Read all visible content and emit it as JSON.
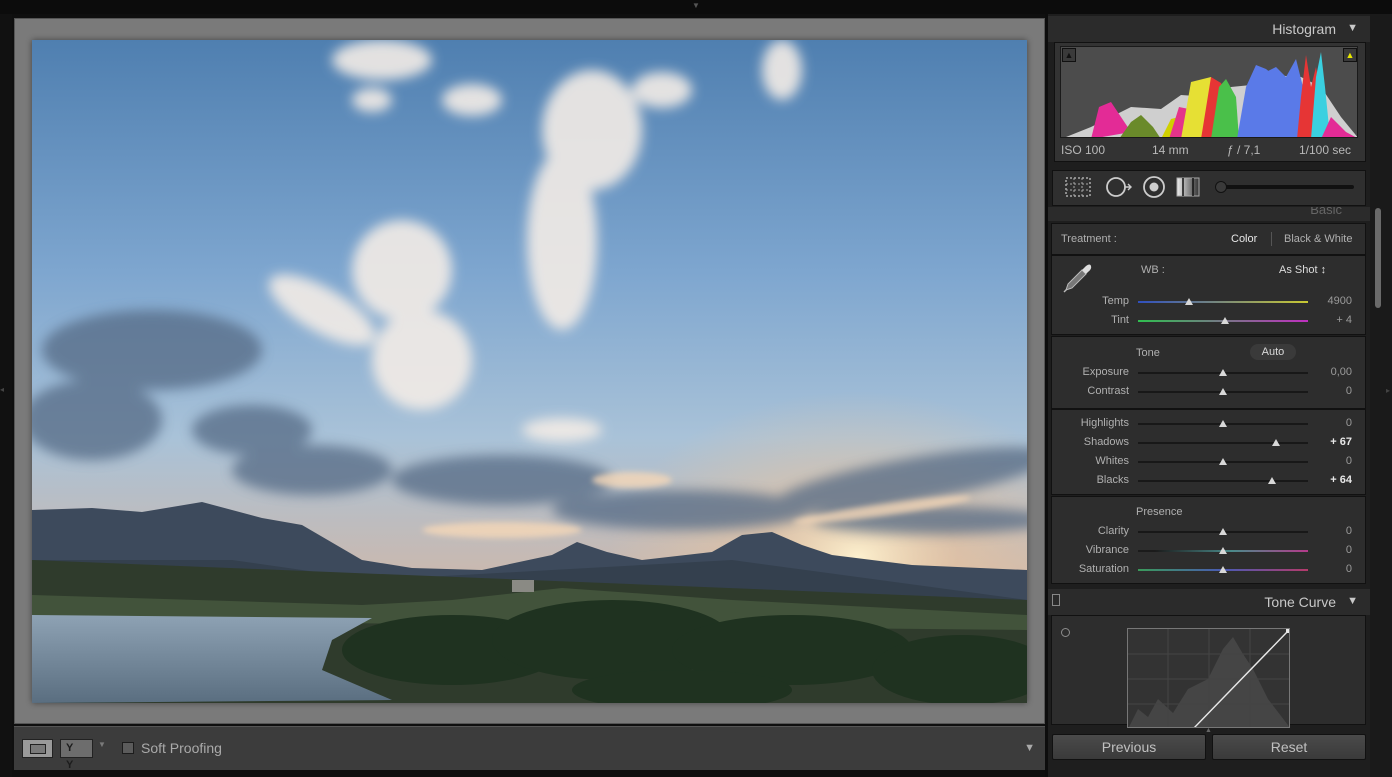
{
  "histogram": {
    "title": "Histogram",
    "exif": {
      "iso": "ISO 100",
      "focal": "14 mm",
      "aperture": "ƒ / 7,1",
      "shutter": "1/100 sec"
    }
  },
  "basic": {
    "title_cut": "Basic",
    "treatment_label": "Treatment :",
    "treatment_options": [
      "Color",
      "Black & White"
    ],
    "wb_label": "WB :",
    "wb_value": "As Shot ↕",
    "wb_sliders": [
      {
        "label": "Temp",
        "value": "4900",
        "fraction": 0.3,
        "bright": false
      },
      {
        "label": "Tint",
        "value": "+ 4",
        "fraction": 0.51,
        "bright": false
      }
    ],
    "tone_label": "Tone",
    "auto_label": "Auto",
    "tone_sliders_a": [
      {
        "label": "Exposure",
        "value": "0,00",
        "fraction": 0.5,
        "bright": false
      },
      {
        "label": "Contrast",
        "value": "0",
        "fraction": 0.5,
        "bright": false
      }
    ],
    "tone_sliders_b": [
      {
        "label": "Highlights",
        "value": "0",
        "fraction": 0.5,
        "bright": false
      },
      {
        "label": "Shadows",
        "value": "+ 67",
        "fraction": 0.81,
        "bright": true
      },
      {
        "label": "Whites",
        "value": "0",
        "fraction": 0.5,
        "bright": false
      },
      {
        "label": "Blacks",
        "value": "+ 64",
        "fraction": 0.79,
        "bright": true
      }
    ],
    "presence_label": "Presence",
    "presence_sliders": [
      {
        "label": "Clarity",
        "value": "0",
        "fraction": 0.5,
        "bright": false
      },
      {
        "label": "Vibrance",
        "value": "0",
        "fraction": 0.5,
        "bright": false
      },
      {
        "label": "Saturation",
        "value": "0",
        "fraction": 0.5,
        "bright": false
      }
    ]
  },
  "tone_curve": {
    "title": "Tone Curve"
  },
  "buttons": {
    "previous": "Previous",
    "reset": "Reset"
  },
  "toolbar": {
    "soft_proofing": "Soft Proofing",
    "compare_label": "Y Y"
  },
  "icons": {
    "crop": "crop-overlay-icon",
    "spot": "spot-removal-icon",
    "redeye": "red-eye-icon",
    "graduated": "graduated-filter-icon",
    "brush": "adjustment-brush-icon"
  }
}
